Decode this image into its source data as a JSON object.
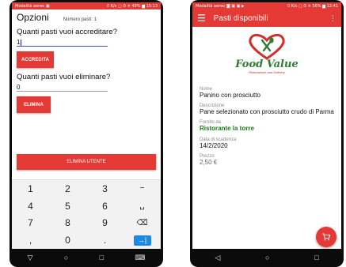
{
  "left": {
    "status": {
      "left": "Modalità aereo ▣",
      "right": "0 K/s ▢ ⏱ ✈ 49% ▆ 15:13"
    },
    "title": "Opzioni",
    "meals_count": "Numero pasti: 1",
    "accredit_question": "Quanti pasti vuoi accreditare?",
    "accredit_value": "1",
    "accredit_button": "ACCREDITA",
    "delete_question": "Quanti pasti vuoi eliminare?",
    "delete_value": "0",
    "delete_button": "ELIMINA",
    "delete_user_button": "ELIMINA UTENTE",
    "keypad": [
      "1",
      "2",
      "3",
      "−",
      "4",
      "5",
      "6",
      "␣",
      "7",
      "8",
      "9",
      "⌫",
      ",",
      "0",
      ".",
      "→|"
    ],
    "nav": [
      "▽",
      "○",
      "□",
      "⌨"
    ]
  },
  "right": {
    "status": {
      "left": "Modalità aereo ◙ ▣ ▣ ▶",
      "right": "0 K/s ▢ ⏱ ✈ 56% ▆ 12:41"
    },
    "app_title": "Pasti disponibili",
    "logo": {
      "name": "Food Value",
      "tagline": "Ristorazione and Delivery"
    },
    "fields": [
      {
        "label": "Nome",
        "value": "Panino con prosciutto"
      },
      {
        "label": "Descrizione",
        "value": "Pane selezionato con prosciutto crudo di Parma"
      },
      {
        "label": "Fornito da",
        "value": "Ristorante la torre"
      },
      {
        "label": "Data di scadenza",
        "value": "14/2/2020"
      },
      {
        "label": "Prezzo",
        "value": "2,50 €"
      }
    ],
    "nav": [
      "◁",
      "○",
      "□"
    ]
  },
  "colors": {
    "accent": "#e53935",
    "green": "#2e7d32",
    "input_active": "#3f51b5"
  },
  "icons": {
    "menu": "menu-icon",
    "more": "more-vert-icon",
    "cart": "cart-icon",
    "backspace": "backspace-icon"
  }
}
